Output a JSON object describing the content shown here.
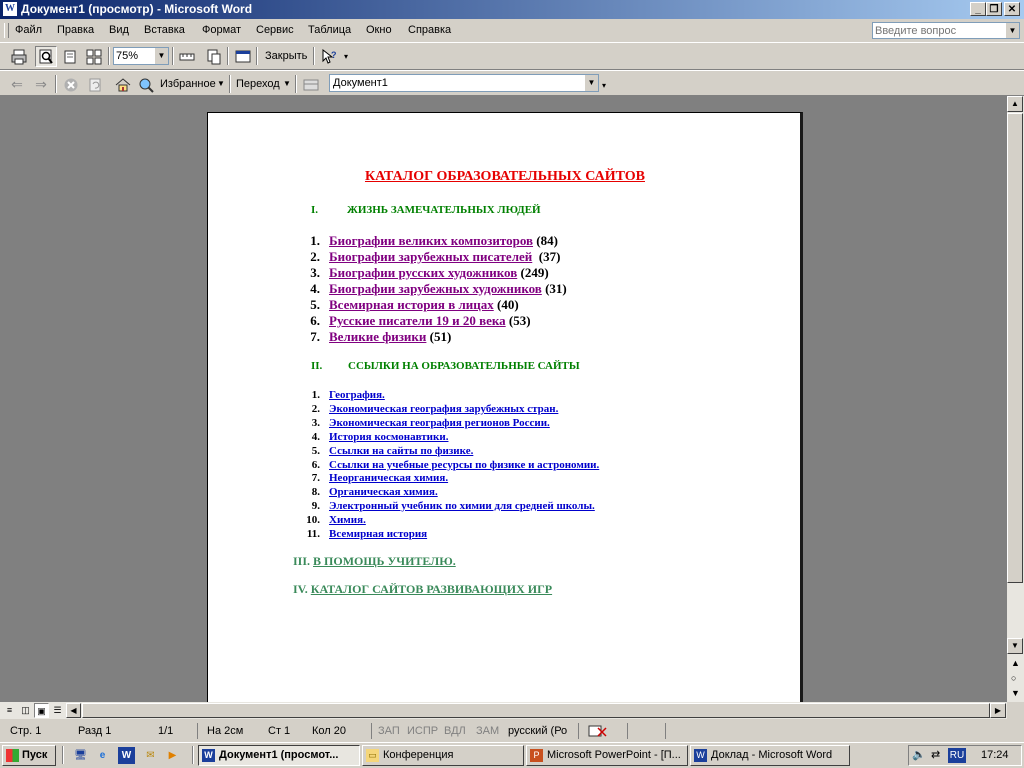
{
  "window": {
    "title": "Документ1 (просмотр) - Microsoft Word",
    "app_icon": "W"
  },
  "menu": {
    "items": [
      "Файл",
      "Правка",
      "Вид",
      "Вставка",
      "Формат",
      "Сервис",
      "Таблица",
      "Окно",
      "Справка"
    ],
    "help_placeholder": "Введите вопрос"
  },
  "toolbar1": {
    "zoom_value": "75%",
    "close_label": "Закрыть"
  },
  "toolbar2": {
    "favorites_label": "Избранное",
    "goto_label": "Переход",
    "address_value": "Документ1"
  },
  "document": {
    "title": "КАТАЛОГ ОБРАЗОВАТЕЛЬНЫХ САЙТОВ",
    "section1": {
      "numeral": "I.",
      "heading": "ЖИЗНЬ ЗАМЕЧАТЕЛЬНЫХ ЛЮДЕЙ",
      "items": [
        {
          "num": "1.",
          "link": "Биографии великих композиторов",
          "count": " (84)"
        },
        {
          "num": "2.",
          "link": "Биографии зарубежных писателей",
          "count": "  (37)"
        },
        {
          "num": "3.",
          "link": "Биографии русских художников",
          "count": " (249)"
        },
        {
          "num": "4.",
          "link": "Биографии зарубежных художников",
          "count": " (31)"
        },
        {
          "num": "5.",
          "link": "Всемирная история в лицах",
          "count": " (40)"
        },
        {
          "num": "6.",
          "link": "Русские писатели 19 и 20 века",
          "count": " (53)"
        },
        {
          "num": "7.",
          "link": "Великие физики",
          "count": " (51)"
        }
      ]
    },
    "section2": {
      "numeral": "II.",
      "heading": "ССЫЛКИ НА ОБРАЗОВАТЕЛЬНЫЕ САЙТЫ",
      "items": [
        {
          "num": "1.",
          "link": "География."
        },
        {
          "num": "2.",
          "link": "Экономическая география зарубежных стран."
        },
        {
          "num": "3.",
          "link": "Экономическая география регионов России."
        },
        {
          "num": "4.",
          "link": "История космонавтики."
        },
        {
          "num": "5.",
          "link": "Ссылки на сайты по физике."
        },
        {
          "num": "6.",
          "link": "Ссылки на учебные ресурсы по физике и астрономии."
        },
        {
          "num": "7.",
          "link": "Неорганическая химия."
        },
        {
          "num": "8.",
          "link": "Органическая химия."
        },
        {
          "num": "9.",
          "link": "Электронный учебник по химии для средней школы."
        },
        {
          "num": "10.",
          "link": "Химия."
        },
        {
          "num": "11.",
          "link": "Всемирная история"
        }
      ]
    },
    "section3": {
      "numeral": "III.",
      "link": "В ПОМОЩЬ УЧИТЕЛЮ."
    },
    "section4": {
      "numeral": "IV.",
      "link": "КАТАЛОГ САЙТОВ РАЗВИВАЮЩИХ ИГР"
    }
  },
  "status": {
    "page": "Стр. 1",
    "section": "Разд 1",
    "pages": "1/1",
    "at": "На 2см",
    "line": "Ст 1",
    "col": "Кол 20",
    "rec": "ЗАП",
    "trk": "ИСПР",
    "ext": "ВДЛ",
    "ovr": "ЗАМ",
    "lang": "русский (Ро"
  },
  "taskbar": {
    "start": "Пуск",
    "tasks": [
      "Документ1 (просмот...",
      "Конференция",
      "Microsoft PowerPoint - [П...",
      "Доклад - Microsoft Word"
    ],
    "lang": "RU",
    "clock": "17:24"
  },
  "colors": {
    "title_red": "#e60000",
    "heading_green": "#008000",
    "visited_link": "#800080",
    "link_blue": "#0000cc"
  }
}
